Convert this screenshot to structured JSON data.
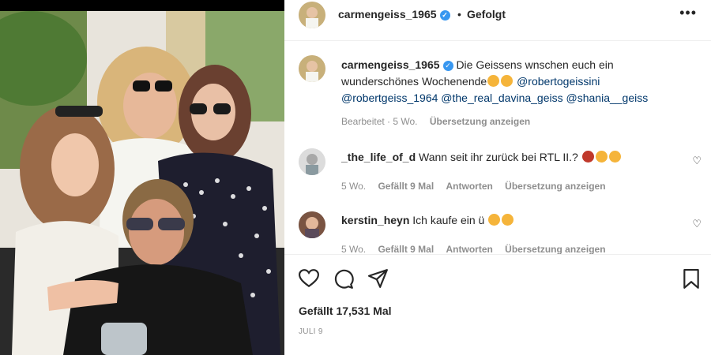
{
  "post": {
    "username": "carmengeiss_1965",
    "follow_status": "Gefolgt",
    "more_label": "•••",
    "caption": {
      "username": "carmengeiss_1965",
      "text": "Die Geissens wnschen euch ein wunderschönes Wochenende",
      "mentions": [
        "@robertogeissini",
        "@robertgeiss_1964",
        "@the_real_davina_geiss",
        "@shania__geiss"
      ],
      "edited_label": "Bearbeitet",
      "age": "5 Wo.",
      "translate_label": "Übersetzung anzeigen"
    },
    "comments": [
      {
        "username": "_the_life_of_d",
        "text": "Wann seit ihr zurück bei RTL II.?",
        "age": "5 Wo.",
        "likes": "Gefällt 9 Mal",
        "reply_label": "Antworten",
        "translate_label": "Übersetzung anzeigen"
      },
      {
        "username": "kerstin_heyn",
        "text": "Ich kaufe ein ü",
        "age": "5 Wo.",
        "likes": "Gefällt 9 Mal",
        "reply_label": "Antworten",
        "translate_label": "Übersetzung anzeigen"
      }
    ],
    "likes_total": "Gefällt 17,531 Mal",
    "date": "JULI 9"
  },
  "icons": {
    "like": "heart-icon",
    "comment": "comment-icon",
    "share": "share-icon",
    "save": "bookmark-icon",
    "verified": "verified-badge-icon"
  },
  "colors": {
    "accent": "#3897f0",
    "mention": "#00376b",
    "muted": "#8e8e8e"
  }
}
